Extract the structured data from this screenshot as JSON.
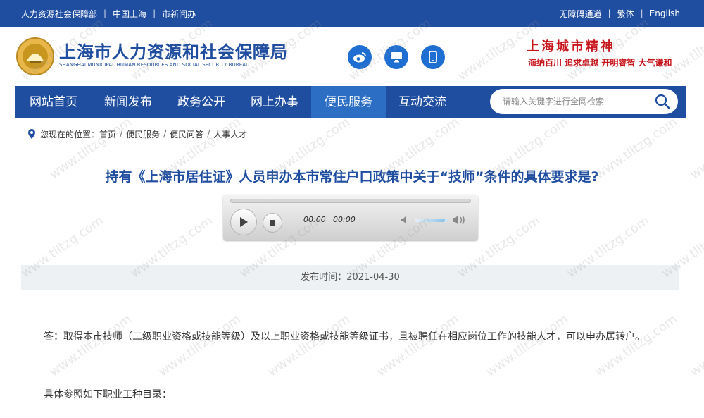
{
  "topbar": {
    "left_links": [
      "人力资源社会保障部",
      "中国上海",
      "市新闻办"
    ],
    "right_links": [
      "无障碍通道",
      "繁体",
      "English"
    ]
  },
  "header": {
    "title": "上海市人力资源和社会保障局",
    "subtitle": "SHANGHAI MUNICIPAL HUMAN RESOURCES AND SOCIAL SECURITY BUREAU",
    "social_icons": [
      "weibo-icon",
      "desktop-icon",
      "mobile-icon"
    ],
    "spirit_title": "上海城市精神",
    "spirit_text": "海纳百川  追求卓越  开明睿智  大气谦和"
  },
  "nav": {
    "items": [
      "网站首页",
      "新闻发布",
      "政务公开",
      "网上办事",
      "便民服务",
      "互动交流"
    ],
    "active": "便民服务",
    "search_placeholder": "请输入关键字进行全网检索"
  },
  "breadcrumb": {
    "prefix": "您现在的位置：",
    "items": [
      "首页",
      "便民服务",
      "便民问答",
      "人事人才"
    ]
  },
  "article": {
    "title": "持有《上海市居住证》人员申办本市常住户口政策中关于“技师”条件的具体要求是?",
    "player": {
      "current_time": "00:00",
      "duration": "00:00",
      "volume": 0.9
    },
    "publish_label": "发布时间：",
    "publish_date": "2021-04-30",
    "paragraph_1": "答：取得本市技师（二级职业资格或技能等级）及以上职业资格或技能等级证书，且被聘任在相应岗位工作的技能人才，可以申办居转户。",
    "paragraph_2": "具体参照如下职业工种目录："
  },
  "watermark": "www.tlltzg.com",
  "colors": {
    "primary": "#1f4da0",
    "active_nav": "#2c6ec4",
    "accent_red": "#c8161d"
  }
}
